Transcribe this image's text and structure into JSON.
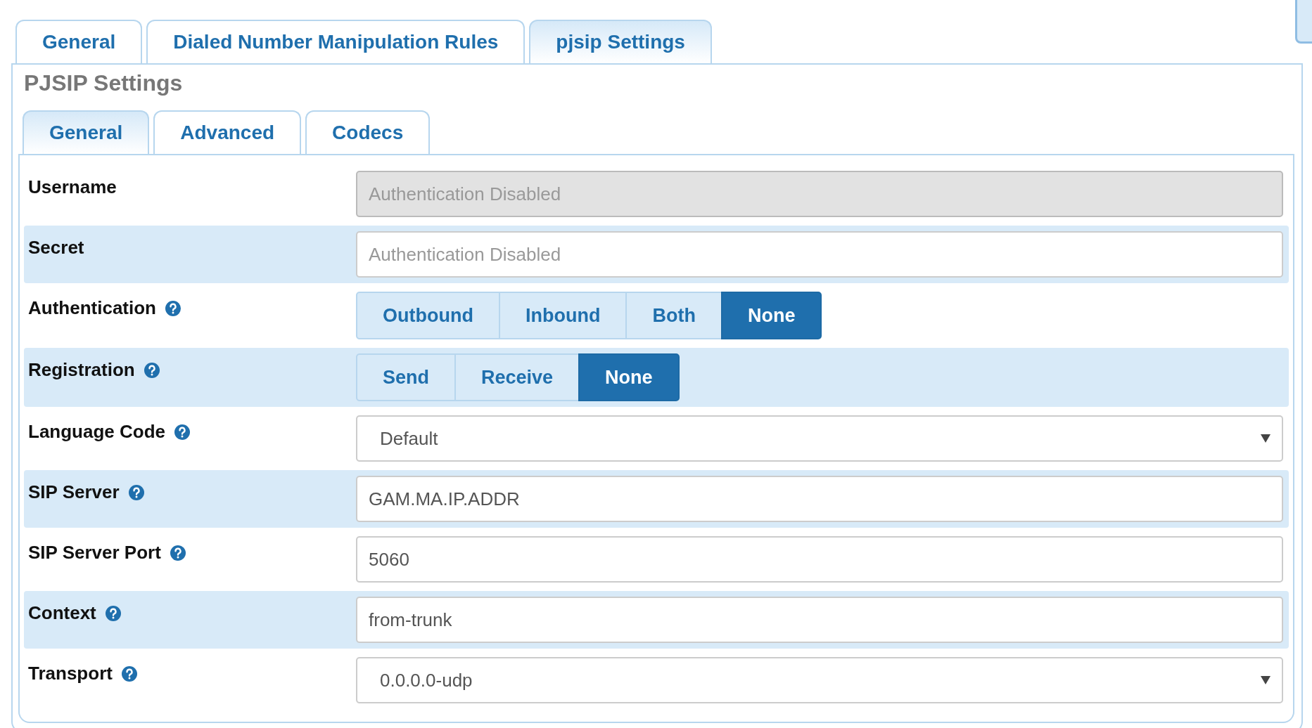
{
  "tabs": [
    {
      "label": "General",
      "selected": false
    },
    {
      "label": "Dialed Number Manipulation Rules",
      "selected": false
    },
    {
      "label": "pjsip Settings",
      "selected": true
    }
  ],
  "section_title": "PJSIP Settings",
  "sub_tabs": [
    {
      "label": "General",
      "selected": true
    },
    {
      "label": "Advanced",
      "selected": false
    },
    {
      "label": "Codecs",
      "selected": false
    }
  ],
  "fields": [
    {
      "kind": "text",
      "label": "Username",
      "help": false,
      "placeholder": "Authentication Disabled",
      "disabled": true
    },
    {
      "kind": "text",
      "label": "Secret",
      "help": false,
      "placeholder": "Authentication Disabled",
      "disabled": false
    },
    {
      "kind": "toggle",
      "label": "Authentication",
      "help": true,
      "options": [
        {
          "label": "Outbound",
          "selected": false
        },
        {
          "label": "Inbound",
          "selected": false
        },
        {
          "label": "Both",
          "selected": false
        },
        {
          "label": "None",
          "selected": true
        }
      ]
    },
    {
      "kind": "toggle",
      "label": "Registration",
      "help": true,
      "options": [
        {
          "label": "Send",
          "selected": false
        },
        {
          "label": "Receive",
          "selected": false
        },
        {
          "label": "None",
          "selected": true
        }
      ]
    },
    {
      "kind": "select",
      "label": "Language Code",
      "help": true,
      "value": "Default"
    },
    {
      "kind": "text",
      "label": "SIP Server",
      "help": true,
      "value": "GAM.MA.IP.ADDR",
      "disabled": false
    },
    {
      "kind": "text",
      "label": "SIP Server Port",
      "help": true,
      "value": "5060",
      "disabled": false
    },
    {
      "kind": "text",
      "label": "Context",
      "help": true,
      "value": "from-trunk",
      "disabled": false
    },
    {
      "kind": "select",
      "label": "Transport",
      "help": true,
      "value": "0.0.0.0-udp"
    }
  ]
}
